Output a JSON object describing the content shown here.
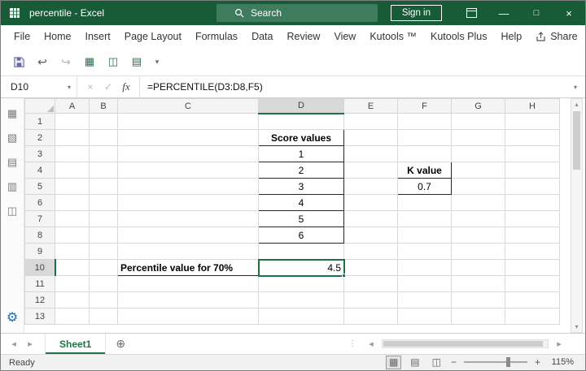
{
  "title_bar": {
    "app_title": "percentile - Excel",
    "search_label": "Search",
    "sign_in_label": "Sign in"
  },
  "menu": {
    "tabs": [
      "File",
      "Home",
      "Insert",
      "Page Layout",
      "Formulas",
      "Data",
      "Review",
      "View",
      "Kutools ™",
      "Kutools Plus",
      "Help"
    ],
    "share_label": "Share"
  },
  "formula_bar": {
    "name_box_value": "D10",
    "fx_label": "fx",
    "formula": "=PERCENTILE(D3:D8,F5)"
  },
  "grid": {
    "column_headers": [
      "A",
      "B",
      "C",
      "D",
      "E",
      "F",
      "G",
      "H"
    ],
    "row_headers": [
      "1",
      "2",
      "3",
      "4",
      "5",
      "6",
      "7",
      "8",
      "9",
      "10",
      "11",
      "12",
      "13"
    ],
    "selected_cell": "D10",
    "selected_column": "D",
    "selected_row": "10",
    "cells": {
      "D2": "Score values",
      "D3": "1",
      "D4": "2",
      "D5": "3",
      "D6": "4",
      "D7": "5",
      "D8": "6",
      "F4": "K value",
      "F5": "0.7",
      "C10": "Percentile value for 70%",
      "D10": "4.5"
    }
  },
  "sheet_bar": {
    "active_sheet": "Sheet1"
  },
  "status_bar": {
    "mode": "Ready",
    "zoom": "115%"
  },
  "colors": {
    "title_bar_green": "#185C37",
    "accent_green": "#217346",
    "selection_border": "#1E7145"
  },
  "icons": {
    "dropdown": "▾",
    "minimize": "—",
    "maximize": "□",
    "close": "×",
    "cancel": "×",
    "enter": "✓",
    "undo": "↩",
    "redo": "↪",
    "qat_table": "▦",
    "qat_window": "◫",
    "qat_doc": "▤",
    "pane_sheet": "▦",
    "pane_doc": "▧",
    "pane_print": "▤",
    "pane_table": "▥",
    "pane_view": "◫",
    "gear": "⚙",
    "prev_sheet": "◂",
    "next_sheet": "▸",
    "add_sheet": "⊕",
    "splitter": "⋮",
    "scroll_up": "▴",
    "scroll_down": "▾",
    "scroll_left": "◂",
    "scroll_right": "▸",
    "view_normal": "▦",
    "view_layout": "▤",
    "view_break": "◫",
    "zoom_out": "−",
    "zoom_in": "+"
  }
}
